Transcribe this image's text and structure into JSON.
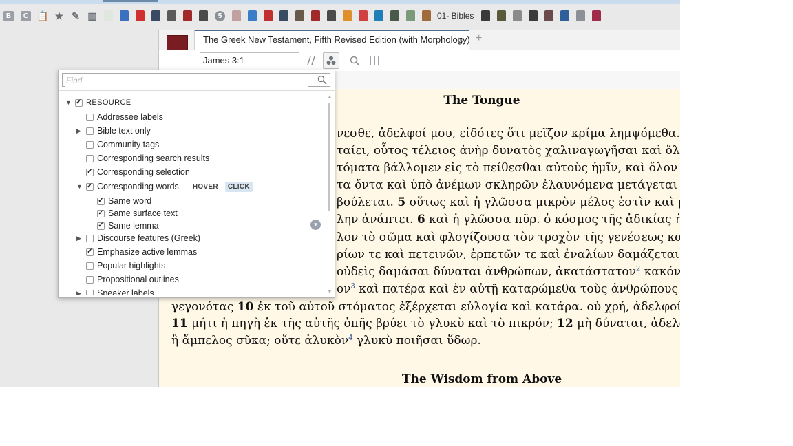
{
  "toolbar_shelf": {
    "items": [
      {
        "icon": "b-badge",
        "text": "B"
      },
      {
        "icon": "c-badge",
        "text": "C"
      },
      {
        "icon": "clipboard-icon"
      },
      {
        "icon": "star-icon"
      },
      {
        "icon": "pen-icon"
      },
      {
        "icon": "books-icon"
      },
      {
        "icon": "book-icon"
      },
      {
        "icon": "book-icon"
      },
      {
        "icon": "book-icon"
      },
      {
        "icon": "book-icon"
      },
      {
        "icon": "book-icon"
      },
      {
        "icon": "book-icon"
      },
      {
        "icon": "book-icon"
      },
      {
        "icon": "five-badge",
        "text": "5"
      },
      {
        "icon": "book-icon"
      }
    ],
    "collection_label": "01- Bibles"
  },
  "panel": {
    "tab_title": "The Greek New Testament, Fifth Revised Edition (with Morphology)",
    "close_glyph": "✕",
    "add_tab_glyph": "+",
    "reference": "James 3:1",
    "toolbar_icons": [
      "parallel-icon",
      "visual-filters-icon",
      "search-icon",
      "columns-icon"
    ]
  },
  "reader": {
    "heading1": "The Tongue",
    "heading2": "The Wisdom from Above",
    "lines": [
      {
        "text": "νεσθε, ἀδελφοί μου, εἰδότες ὅτι μεῖζον κρίμα λημψόμεθα. ",
        "verse": "2",
        "tail": " π"
      },
      {
        "text": "ταίει, οὗτος τέλειος ἀνὴρ δυνατὸς χαλιναγωγῆσαι καὶ ὅλον τὸ"
      },
      {
        "text": "τόματα βάλλομεν εἰς τὸ πείθεσθαι αὐτοὺς ἡμῖν, καὶ ὅλον τὸ σῶμ"
      },
      {
        "text": "τα ὄντα καὶ ὑπὸ ἀνέμων σκληρῶν ἐλαυνόμενα μετάγεται ὑπὸ"
      },
      {
        "text": "βούλεται. ",
        "verse": "5",
        "tail": " οὕτως καὶ ἡ γλῶσσα μικρὸν μέλος ἐστὶν καὶ μεγάλα α"
      },
      {
        "text": "λην ἀνάπτει. ",
        "verse": "6",
        "tail": " καὶ ἡ γλῶσσα πῦρ. ὁ κόσμος τῆς ἀδικίας ἡ γλῶσσ"
      },
      {
        "text": "λον τὸ σῶμα καὶ φλογίζουσα τὸν τροχὸν τῆς γενέσεως καὶ φ"
      },
      {
        "text": "ρίων τε καὶ πετεινῶν, ἑρπετῶν τε καὶ ἐναλίων δαμάζεται καὶ δεδ"
      },
      {
        "text": "οὐδεὶς δαμάσαι δύναται ἀνθρώπων, ἀκατάστατον",
        "sup": "2",
        "tail": " κακόν, μεστ"
      },
      {
        "text": "ον",
        "sup": "3",
        "tail": " καὶ πατέρα καὶ ἐν αὐτῇ καταρώμεθα τοὺς ἀνθρώπους τοὺς"
      },
      {
        "text": "γεγονότας ",
        "verse": "10",
        "tail": " ἐκ τοῦ αὐτοῦ στόματος ἐξέρχεται εὐλογία καὶ κατάρα. οὐ χρή, ἀδελφοί μου, τα"
      },
      {
        "verse": "11",
        "tail": " μήτι ἡ πηγὴ ἐκ τῆς αὐτῆς ὀπῆς βρύει τὸ γλυκὺ καὶ τὸ πικρόν; ",
        "verse2": "12",
        "tail2": " μὴ δύναται, ἀδελφοί μου,"
      },
      {
        "text": "ἢ ἄμπελος σῦκα; οὔτε ἁλυκὸν",
        "sup": "4",
        "tail": " γλυκὺ ποιῆσαι ὕδωρ."
      }
    ]
  },
  "popup": {
    "find_placeholder": "Find",
    "tree": [
      {
        "label": "RESOURCE",
        "checked": true,
        "expand": "open",
        "level": 0,
        "header": true
      },
      {
        "label": "Addressee labels",
        "checked": false,
        "expand": "none",
        "level": 1
      },
      {
        "label": "Bible text only",
        "checked": false,
        "expand": "closed",
        "level": 1
      },
      {
        "label": "Community tags",
        "checked": false,
        "expand": "none",
        "level": 1
      },
      {
        "label": "Corresponding search results",
        "checked": false,
        "expand": "none",
        "level": 1
      },
      {
        "label": "Corresponding selection",
        "checked": true,
        "expand": "none",
        "level": 1
      },
      {
        "label": "Corresponding words",
        "checked": true,
        "expand": "open",
        "level": 1,
        "pills": [
          "HOVER",
          "CLICK"
        ]
      },
      {
        "label": "Same word",
        "checked": true,
        "expand": "none",
        "level": 2
      },
      {
        "label": "Same surface text",
        "checked": true,
        "expand": "none",
        "level": 2
      },
      {
        "label": "Same lemma",
        "checked": true,
        "expand": "none",
        "level": 2
      },
      {
        "label": "Discourse features (Greek)",
        "checked": false,
        "expand": "closed",
        "level": 1
      },
      {
        "label": "Emphasize active lemmas",
        "checked": true,
        "expand": "none",
        "level": 1
      },
      {
        "label": "Popular highlights",
        "checked": false,
        "expand": "none",
        "level": 1
      },
      {
        "label": "Propositional outlines",
        "checked": false,
        "expand": "none",
        "level": 1
      },
      {
        "label": "Speaker labels",
        "checked": false,
        "expand": "closed",
        "level": 1
      }
    ]
  },
  "colors": {
    "reader_bg": "#fff8e7",
    "tab_accent": "#4d6e8f",
    "click_pill_bg": "#d7e6f2",
    "cover": "#7a1d22"
  }
}
